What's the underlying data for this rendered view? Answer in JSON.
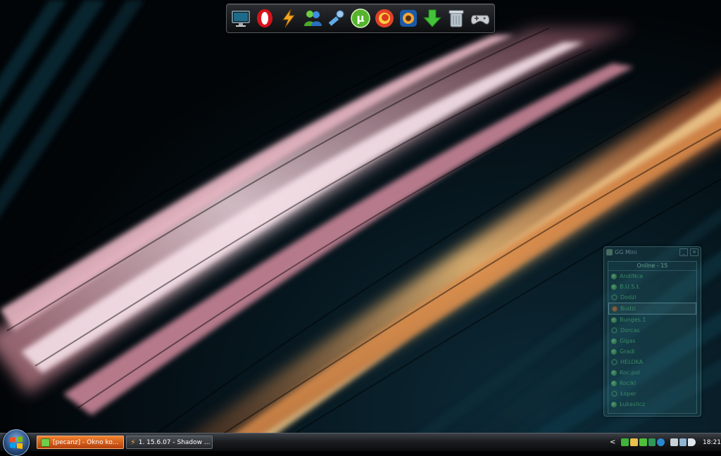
{
  "dock": {
    "items": [
      {
        "name": "monitor-icon",
        "label": "Computer"
      },
      {
        "name": "opera-icon",
        "label": "Opera"
      },
      {
        "name": "winamp-icon",
        "label": "Winamp"
      },
      {
        "name": "messenger-icon",
        "label": "Messenger"
      },
      {
        "name": "tools-icon",
        "label": "Tools"
      },
      {
        "name": "utorrent-icon",
        "label": "uTorrent"
      },
      {
        "name": "firefox-icon",
        "label": "Firefox"
      },
      {
        "name": "media-player-icon",
        "label": "Media Player"
      },
      {
        "name": "download-icon",
        "label": "Download"
      },
      {
        "name": "recycle-bin-icon",
        "label": "Recycle Bin"
      },
      {
        "name": "gamepad-icon",
        "label": "Games"
      }
    ]
  },
  "im_window": {
    "title": "GG Mini",
    "group": "Online - 15",
    "contacts": [
      {
        "name": "AndiNca",
        "status": "online"
      },
      {
        "name": "B.U.S.Ł",
        "status": "online"
      },
      {
        "name": "Dodzi",
        "status": "online"
      },
      {
        "name": "Budzi",
        "status": "busy"
      },
      {
        "name": "Bunges.1",
        "status": "online"
      },
      {
        "name": "Dorcas",
        "status": "online"
      },
      {
        "name": "Gigas",
        "status": "online"
      },
      {
        "name": "Gradi",
        "status": "online"
      },
      {
        "name": "HELOKA",
        "status": "online"
      },
      {
        "name": "Koc.pol",
        "status": "online"
      },
      {
        "name": "Kocikl",
        "status": "online"
      },
      {
        "name": "Łoper",
        "status": "online"
      },
      {
        "name": "Łukaslicz",
        "status": "online"
      }
    ]
  },
  "taskbar": {
    "tasks": [
      {
        "label": "[pecanz] - Okno ko...",
        "active": true
      },
      {
        "label": "1. 15.6.07 - Shadow ...",
        "active": false
      }
    ],
    "tray": {
      "chevron": "<",
      "clock": "18:21"
    }
  }
}
